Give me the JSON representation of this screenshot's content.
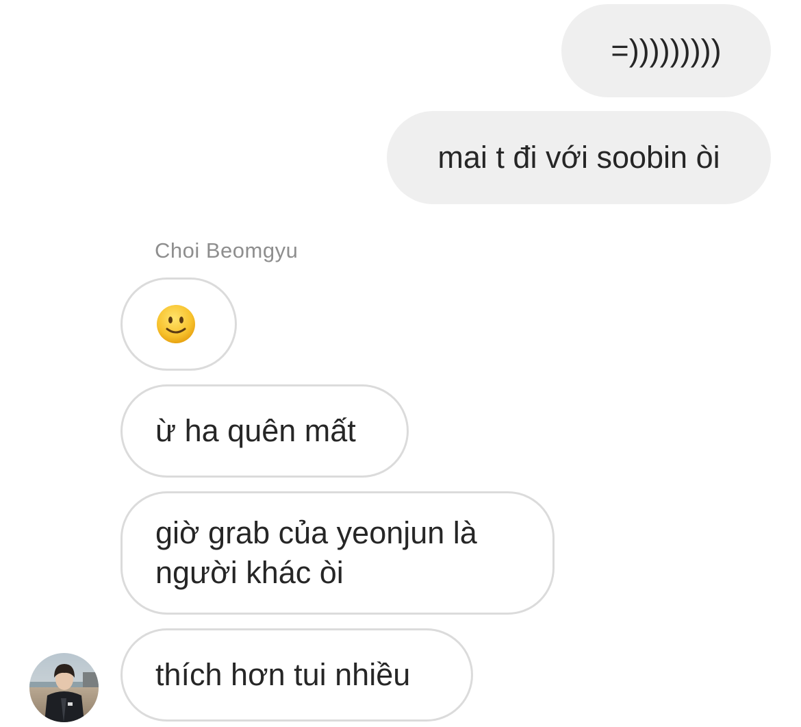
{
  "thread": {
    "outgoing": [
      {
        "text": "=)))))))))"
      },
      {
        "text": "mai t đi với soobin òi"
      }
    ],
    "sender_name": "Choi Beomgyu",
    "incoming": [
      {
        "emoji": "slightly-smiling-face-emoji"
      },
      {
        "text": "ừ ha quên mất"
      },
      {
        "text": "giờ grab của yeonjun là người khác òi"
      },
      {
        "text": "thích hơn tui nhiều"
      }
    ],
    "avatar": {
      "icon": "profile-photo"
    }
  },
  "colors": {
    "outgoing_bubble": "#efefef",
    "incoming_border": "#dbdbdb",
    "text": "#262626",
    "sender_name": "#8e8e8e",
    "emoji_face": "#f7c22d"
  }
}
